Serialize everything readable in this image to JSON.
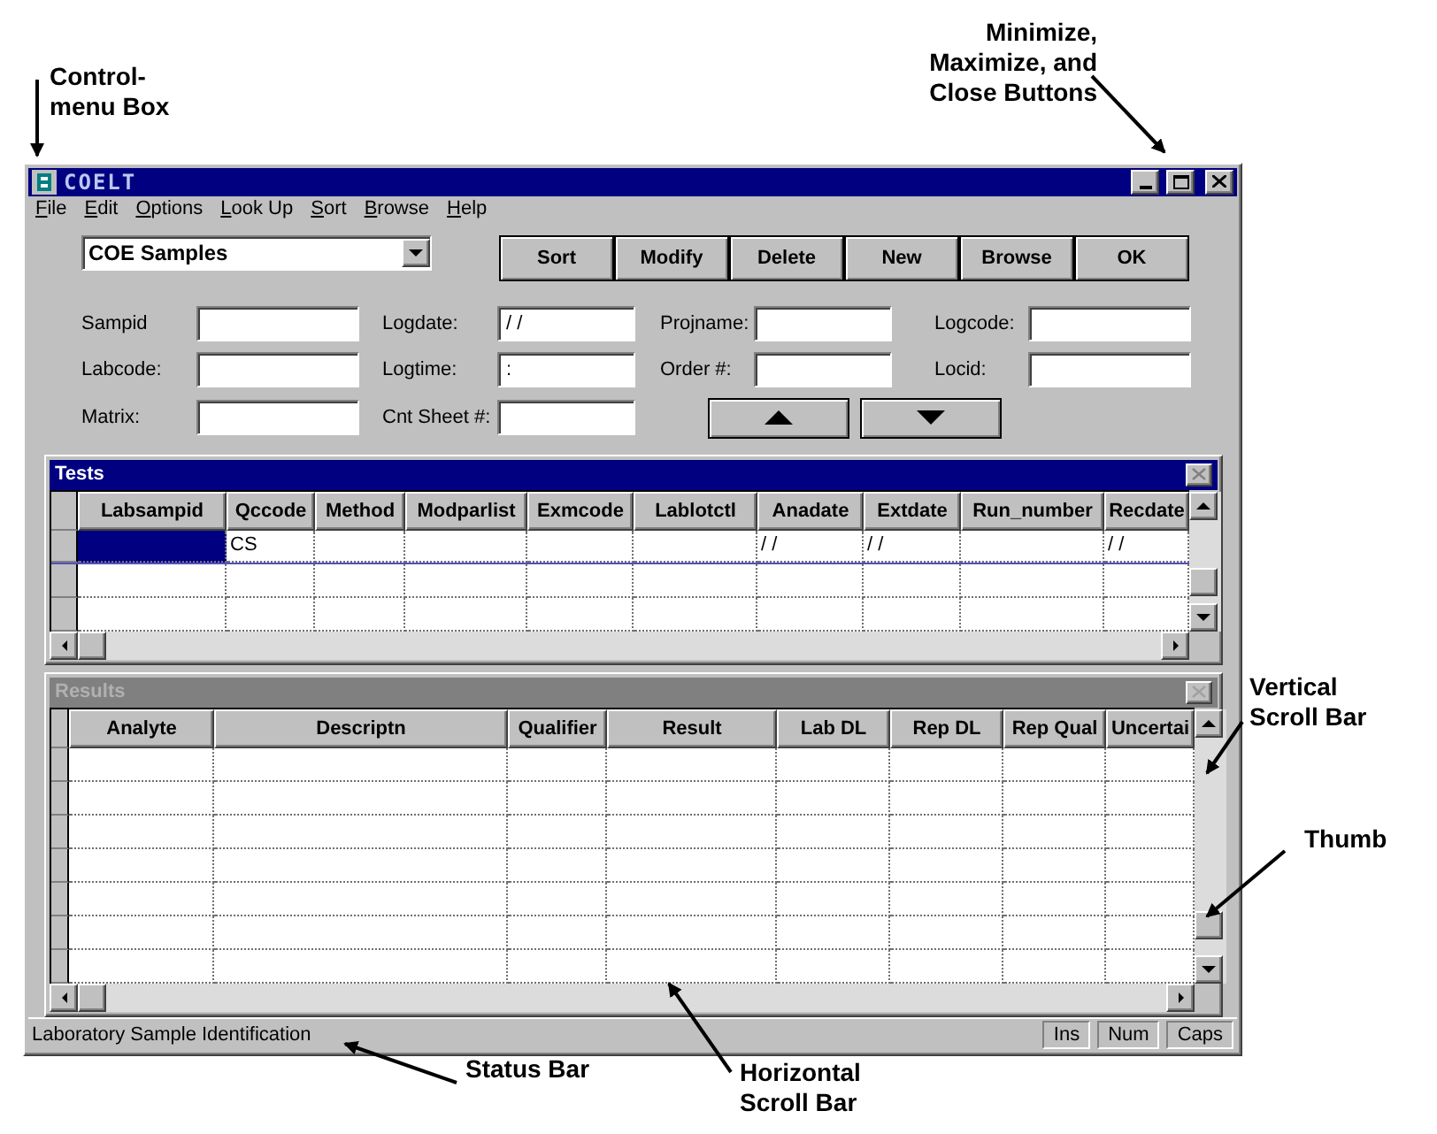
{
  "window": {
    "title": "COELT",
    "controls": [
      {
        "kind": "minimize"
      },
      {
        "kind": "maximize"
      },
      {
        "kind": "close"
      }
    ]
  },
  "menu": [
    "File",
    "Edit",
    "Options",
    "Look Up",
    "Sort",
    "Browse",
    "Help"
  ],
  "view_select": {
    "value": "COE Samples"
  },
  "buttons": [
    "Sort",
    "Modify",
    "Delete",
    "New",
    "Browse",
    "OK"
  ],
  "fields": [
    {
      "label": "Sampid"
    },
    {
      "label": "Logdate:",
      "value": "/ /"
    },
    {
      "label": "Projname:"
    },
    {
      "label": "Logcode:"
    },
    {
      "label": "Labcode:"
    },
    {
      "label": "Logtime:",
      "value": ":"
    },
    {
      "label": "Order #:"
    },
    {
      "label": "Locid:"
    },
    {
      "label": "Matrix:"
    },
    {
      "label": "Cnt Sheet #:"
    }
  ],
  "nav_buttons": [
    {
      "kind": "up"
    },
    {
      "kind": "down"
    }
  ],
  "tests": {
    "title": "Tests",
    "active": true,
    "columns": [
      "Labsampid",
      "Qccode",
      "Method",
      "Modparlist",
      "Exmcode",
      "Lablotctl",
      "Anadate",
      "Extdate",
      "Run_number",
      "Recdate"
    ],
    "rows": [
      {
        "selected": true,
        "cells": [
          null,
          "CS",
          null,
          null,
          null,
          null,
          "/ /",
          "/ /",
          null,
          "/ /"
        ]
      },
      {
        "selected": false
      },
      {
        "selected": false
      }
    ]
  },
  "results": {
    "title": "Results",
    "active": false,
    "columns": [
      "Analyte",
      "Descriptn",
      "Qualifier",
      "Result",
      "Lab DL",
      "Rep DL",
      "Rep Qual",
      "Uncertai"
    ],
    "rows": [
      {
        "selected": false
      },
      {
        "selected": false
      },
      {
        "selected": false
      },
      {
        "selected": false
      },
      {
        "selected": false
      },
      {
        "selected": false
      },
      {
        "selected": false
      }
    ]
  },
  "status_bar": {
    "text": "Laboratory Sample Identification",
    "indicators": [
      "Ins",
      "Num",
      "Caps"
    ]
  },
  "annotations": [
    {
      "lines": [
        "Control-",
        "menu Box"
      ]
    },
    {
      "lines": [
        "Minimize,",
        "Maximize, and",
        "Close Buttons"
      ]
    },
    {
      "lines": [
        "Vertical",
        "Scroll Bar"
      ]
    },
    {
      "lines": [
        "Thumb"
      ]
    },
    {
      "lines": [
        "Status Bar"
      ]
    },
    {
      "lines": [
        "Horizontal",
        "Scroll Bar"
      ]
    }
  ]
}
